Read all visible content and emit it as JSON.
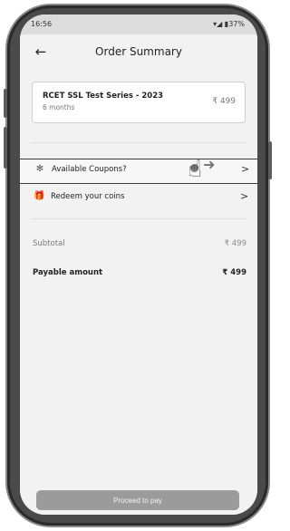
{
  "status_bar": {
    "time": "16:56",
    "icons": "▾◢ ▮37%"
  },
  "header": {
    "title": "Order Summary",
    "back_icon": "←"
  },
  "product": {
    "name": "RCET SSL Test Series - 2023",
    "duration": "6 months",
    "price": "₹ 499"
  },
  "options": [
    {
      "label": "Available Coupons?",
      "icon": "coupon-icon",
      "chevron": ">"
    },
    {
      "label": "Redeem your coins",
      "icon": "gift-icon",
      "chevron": ">"
    }
  ],
  "summary": {
    "subtotal_label": "Subtotal",
    "subtotal_value": "₹ 499",
    "payable_label": "Payable amount",
    "payable_value": "₹ 499"
  },
  "cta": {
    "label": "Proceed to pay"
  },
  "colors": {
    "screen_bg": "#f2f2f2",
    "button_bg": "#9b9b9b"
  }
}
